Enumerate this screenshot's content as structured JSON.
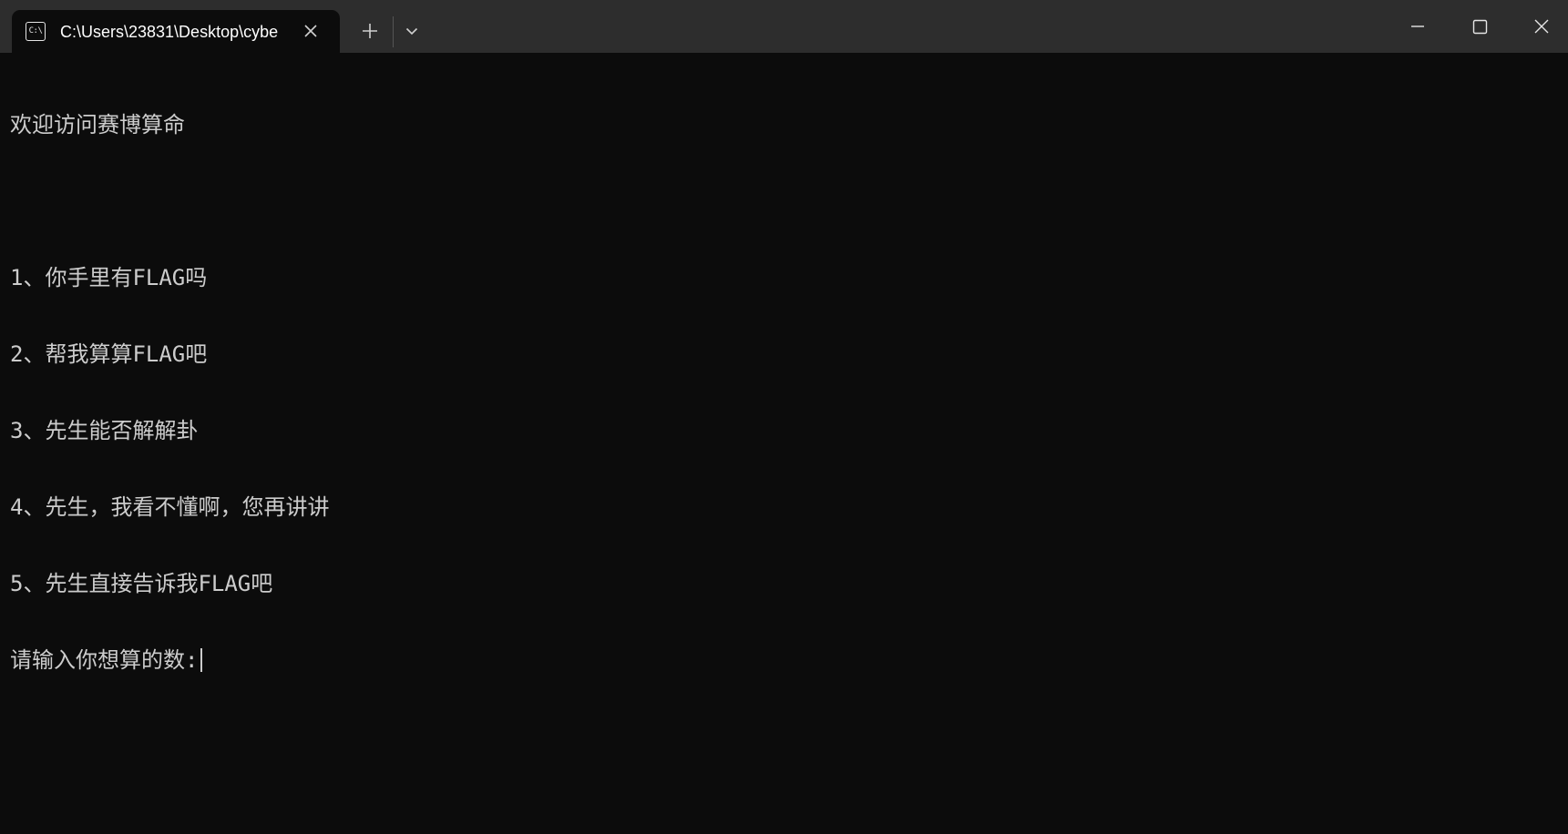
{
  "window": {
    "tab_title": "C:\\Users\\23831\\Desktop\\cybe",
    "tab_icon": "terminal-icon",
    "tab_icon_text": "C:\\",
    "buttons": {
      "tab_close": "close-icon",
      "new_tab": "plus-icon",
      "dropdown": "chevron-down-icon",
      "minimize": "minimize-icon",
      "maximize": "maximize-icon",
      "close": "close-icon"
    }
  },
  "console": {
    "lines": [
      "欢迎访问赛博算命",
      "",
      "1、你手里有FLAG吗",
      "2、帮我算算FLAG吧",
      "3、先生能否解解卦",
      "4、先生，我看不懂啊，您再讲讲",
      "5、先生直接告诉我FLAG吧"
    ],
    "prompt": "请输入你想算的数:"
  },
  "colors": {
    "titlebar_bg": "#2d2d2d",
    "console_bg": "#0c0c0c",
    "console_fg": "#cccccc"
  }
}
